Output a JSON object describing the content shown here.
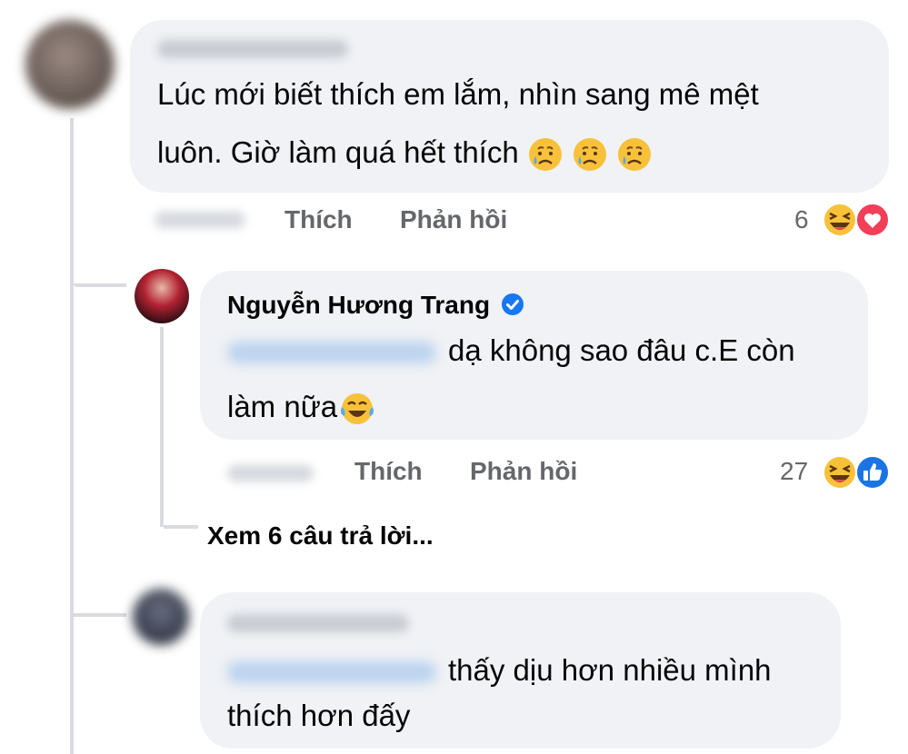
{
  "comment1": {
    "text_line1": "Lúc mới biết thích em lắm, nhìn sang mê mệt",
    "text_line2": "luôn. Giờ làm quá hết thích",
    "text_emojis": [
      "sad-relieved-face-emoji",
      "sad-relieved-face-emoji",
      "sad-relieved-face-emoji"
    ],
    "like_label": "Thích",
    "reply_label": "Phản hồi",
    "reaction_count": "6",
    "reactions": [
      "haha-emoji",
      "love-emoji"
    ]
  },
  "reply1": {
    "author": "Nguyễn Hương Trang",
    "verified_icon": "verified-badge-icon",
    "text_line1": "dạ không sao đâu c.E còn",
    "text_line2": "làm nữa",
    "text_emoji": "tears-of-joy-emoji",
    "like_label": "Thích",
    "reply_label": "Phản hồi",
    "reaction_count": "27",
    "reactions": [
      "haha-emoji",
      "like-emoji"
    ]
  },
  "view_replies": "Xem 6 câu trả lời...",
  "comment2": {
    "text_line1": "thấy dịu hơn nhiều mình",
    "text_line2": "thích hơn đấy"
  },
  "colors": {
    "bubble": "#f0f2f5",
    "secondary_text": "#65676b",
    "verified": "#1877f2",
    "thread_line": "#d9dbe0"
  }
}
